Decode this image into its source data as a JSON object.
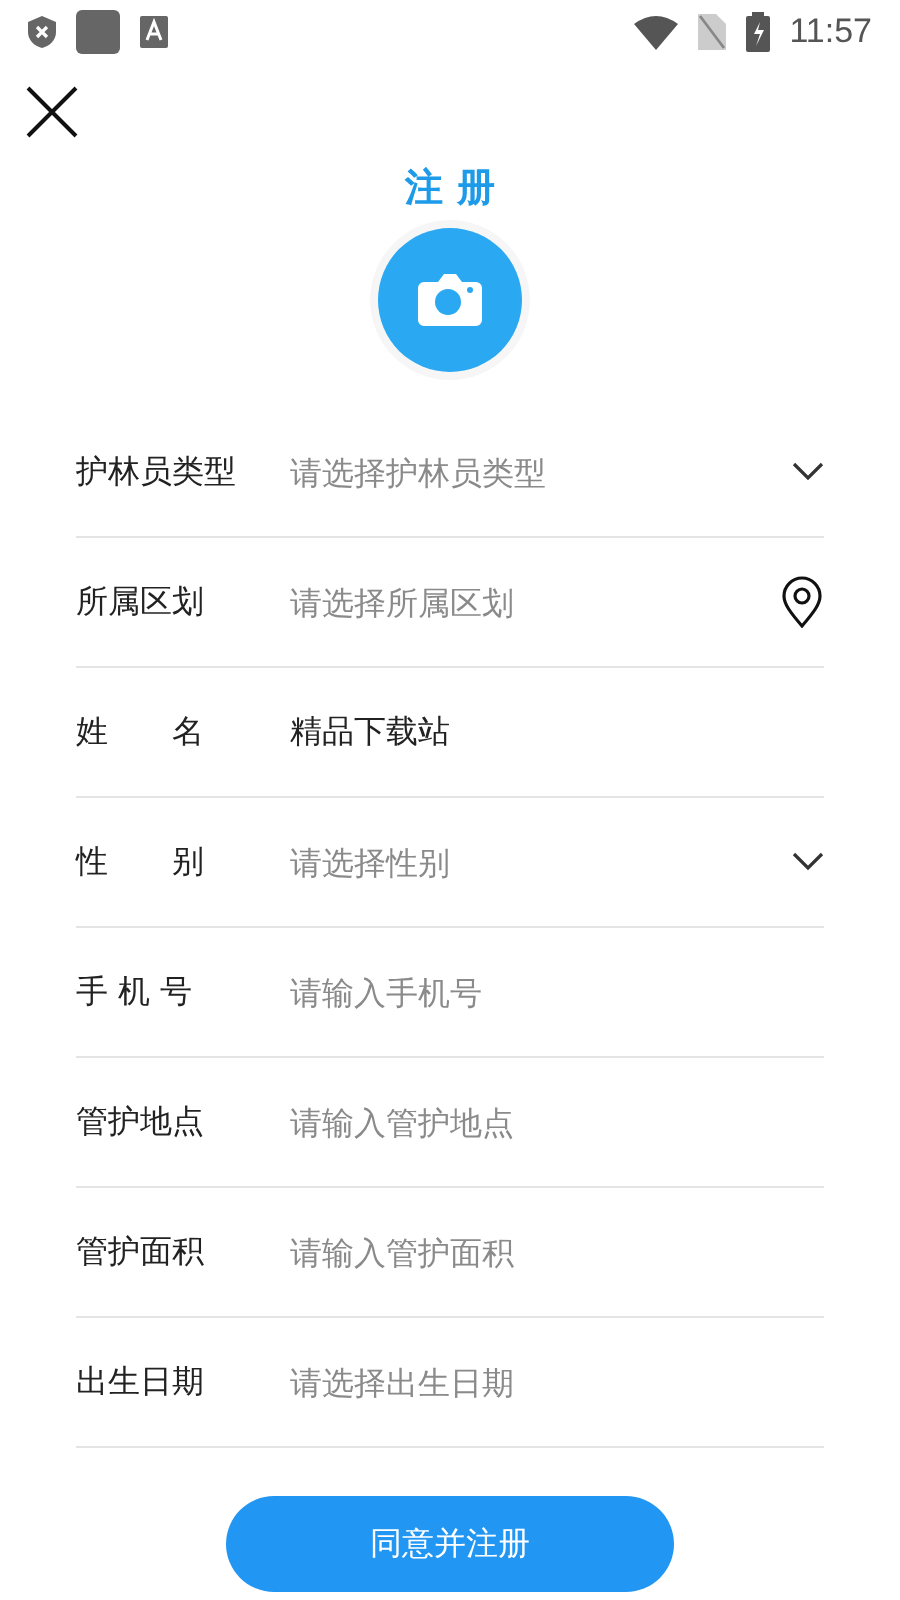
{
  "status_bar": {
    "time": "11:57"
  },
  "title": "注 册",
  "fields": [
    {
      "label": "护林员类型",
      "kind": "select",
      "placeholder": "请选择护林员类型"
    },
    {
      "label": "所属区划",
      "kind": "location",
      "placeholder": "请选择所属区划"
    },
    {
      "label": "姓　　名",
      "kind": "input",
      "value": "精品下载站"
    },
    {
      "label": "性　　别",
      "kind": "select",
      "placeholder": "请选择性别"
    },
    {
      "label": "手 机 号",
      "kind": "input",
      "placeholder": "请输入手机号"
    },
    {
      "label": "管护地点",
      "kind": "input",
      "placeholder": "请输入管护地点"
    },
    {
      "label": "管护面积",
      "kind": "input",
      "placeholder": "请输入管护面积"
    },
    {
      "label": "出生日期",
      "kind": "input",
      "placeholder": "请选择出生日期"
    }
  ],
  "submit": "同意并注册"
}
